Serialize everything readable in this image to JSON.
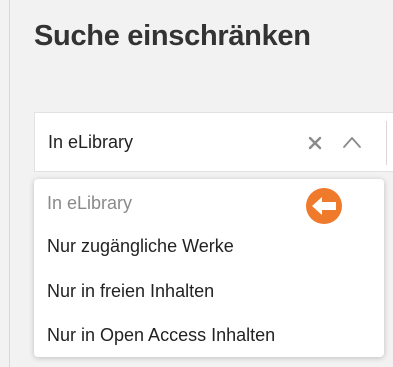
{
  "filter": {
    "title": "Suche einschränken",
    "select": {
      "value": "In eLibrary",
      "clear_icon": "close-icon",
      "toggle_icon": "chevron-up-icon"
    },
    "options": [
      {
        "label": "In eLibrary",
        "selected": true
      },
      {
        "label": "Nur zugängliche Werke",
        "selected": false
      },
      {
        "label": "Nur in freien Inhalten",
        "selected": false
      },
      {
        "label": "Nur in Open Access Inhalten",
        "selected": false
      }
    ],
    "marker_icon": "orange-arrow-left-icon"
  },
  "colors": {
    "background": "#f2f2f2",
    "title": "#333333",
    "text": "#222222",
    "selected_option": "#8a8a8a",
    "accent": "#f07a2c",
    "icon_gray": "#8a8a8a"
  }
}
